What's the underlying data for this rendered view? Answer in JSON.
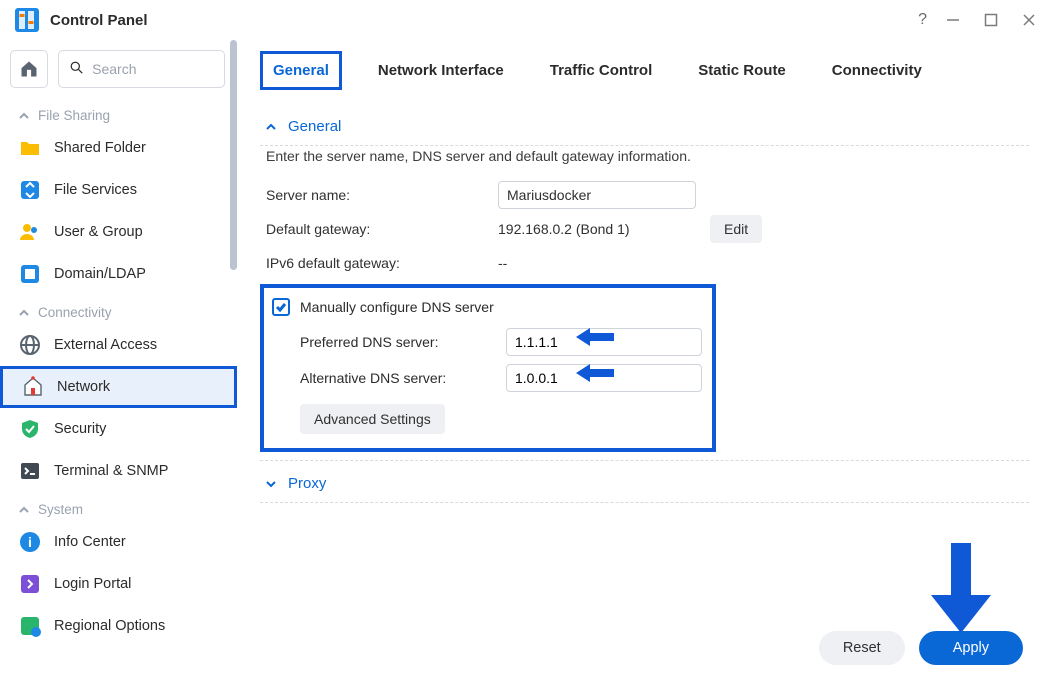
{
  "window": {
    "title": "Control Panel"
  },
  "search": {
    "placeholder": "Search"
  },
  "sidebar": {
    "sections": [
      {
        "label": "File Sharing",
        "items": [
          {
            "id": "shared-folder",
            "label": "Shared Folder"
          },
          {
            "id": "file-services",
            "label": "File Services"
          },
          {
            "id": "user-group",
            "label": "User & Group"
          },
          {
            "id": "domain-ldap",
            "label": "Domain/LDAP"
          }
        ]
      },
      {
        "label": "Connectivity",
        "items": [
          {
            "id": "external-access",
            "label": "External Access"
          },
          {
            "id": "network",
            "label": "Network",
            "selected": true
          },
          {
            "id": "security",
            "label": "Security"
          },
          {
            "id": "terminal-snmp",
            "label": "Terminal & SNMP"
          }
        ]
      },
      {
        "label": "System",
        "items": [
          {
            "id": "info-center",
            "label": "Info Center"
          },
          {
            "id": "login-portal",
            "label": "Login Portal"
          },
          {
            "id": "regional-options",
            "label": "Regional Options"
          }
        ]
      }
    ]
  },
  "tabs": {
    "items": [
      {
        "id": "general",
        "label": "General",
        "active": true
      },
      {
        "id": "network-interface",
        "label": "Network Interface"
      },
      {
        "id": "traffic-control",
        "label": "Traffic Control"
      },
      {
        "id": "static-route",
        "label": "Static Route"
      },
      {
        "id": "connectivity",
        "label": "Connectivity"
      }
    ]
  },
  "general": {
    "title": "General",
    "description": "Enter the server name, DNS server and default gateway information.",
    "server_name_label": "Server name:",
    "server_name_value": "Mariusdocker",
    "default_gw_label": "Default gateway:",
    "default_gw_value": "192.168.0.2 (Bond 1)",
    "edit_btn": "Edit",
    "ipv6_gw_label": "IPv6 default gateway:",
    "ipv6_gw_value": "--",
    "dns": {
      "checkbox_label": "Manually configure DNS server",
      "preferred_label": "Preferred DNS server:",
      "preferred_value": "1.1.1.1",
      "alternative_label": "Alternative DNS server:",
      "alternative_value": "1.0.0.1",
      "advanced_btn": "Advanced Settings"
    }
  },
  "proxy": {
    "title": "Proxy"
  },
  "footer": {
    "reset": "Reset",
    "apply": "Apply"
  }
}
